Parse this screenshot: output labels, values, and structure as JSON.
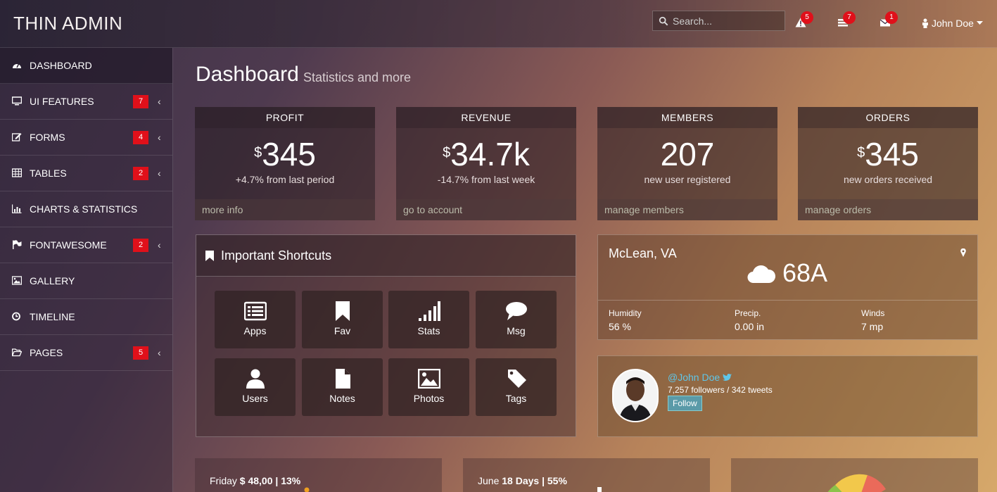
{
  "app": {
    "title": "THIN ADMIN"
  },
  "search": {
    "placeholder": "Search..."
  },
  "notifications": [
    {
      "icon": "warning-icon",
      "count": "5"
    },
    {
      "icon": "tasks-icon",
      "count": "7"
    },
    {
      "icon": "envelope-icon",
      "count": "1"
    }
  ],
  "user": {
    "name": "John Doe"
  },
  "sidebar": {
    "items": [
      {
        "label": "DASHBOARD",
        "icon": "dashboard-icon",
        "badge": ""
      },
      {
        "label": "UI FEATURES",
        "icon": "desktop-icon",
        "badge": "7"
      },
      {
        "label": "FORMS",
        "icon": "edit-icon",
        "badge": "4"
      },
      {
        "label": "TABLES",
        "icon": "table-icon",
        "badge": "2"
      },
      {
        "label": "CHARTS & STATISTICS",
        "icon": "bar-chart-icon",
        "badge": ""
      },
      {
        "label": "FONTAWESOME",
        "icon": "flag-icon",
        "badge": "2"
      },
      {
        "label": "GALLERY",
        "icon": "picture-icon",
        "badge": ""
      },
      {
        "label": "TIMELINE",
        "icon": "clock-icon",
        "badge": ""
      },
      {
        "label": "PAGES",
        "icon": "folder-open-icon",
        "badge": "5"
      }
    ],
    "chevron": "‹"
  },
  "page": {
    "title": "Dashboard",
    "subtitle": "Statistics and more"
  },
  "stats": [
    {
      "head": "PROFIT",
      "currency": "$",
      "value": "345",
      "sub": "+4.7% from last period",
      "foot": "more info"
    },
    {
      "head": "REVENUE",
      "currency": "$",
      "value": "34.7k",
      "sub": "-14.7% from last week",
      "foot": "go to account"
    },
    {
      "head": "MEMBERS",
      "currency": "",
      "value": "207",
      "sub": "new user registered",
      "foot": "manage members"
    },
    {
      "head": "ORDERS",
      "currency": "$",
      "value": "345",
      "sub": "new orders received",
      "foot": "manage orders"
    }
  ],
  "shortcuts": {
    "title": "Important Shortcuts",
    "tiles": [
      {
        "label": "Apps",
        "icon": "list-alt-icon"
      },
      {
        "label": "Fav",
        "icon": "bookmark-icon"
      },
      {
        "label": "Stats",
        "icon": "signal-icon"
      },
      {
        "label": "Msg",
        "icon": "comment-icon"
      },
      {
        "label": "Users",
        "icon": "user-icon"
      },
      {
        "label": "Notes",
        "icon": "file-icon"
      },
      {
        "label": "Photos",
        "icon": "picture-icon"
      },
      {
        "label": "Tags",
        "icon": "tag-icon"
      }
    ]
  },
  "weather": {
    "location": "McLean, VA",
    "temp": "68A",
    "cols": [
      {
        "label": "Humidity",
        "value": "56 %"
      },
      {
        "label": "Precip.",
        "value": "0.00 in"
      },
      {
        "label": "Winds",
        "value": "7 mp"
      }
    ]
  },
  "twitter": {
    "handle": "@John Doe",
    "stats": "7,257 followers / 342 tweets",
    "follow": "Follow"
  },
  "mini": [
    {
      "label": "Friday",
      "bold": "$ 48,00 | 13%"
    },
    {
      "label": "June",
      "bold": "18 Days | 55%"
    }
  ],
  "colors": {
    "badge": "#e0101a",
    "twitter": "#5fc6e8"
  }
}
